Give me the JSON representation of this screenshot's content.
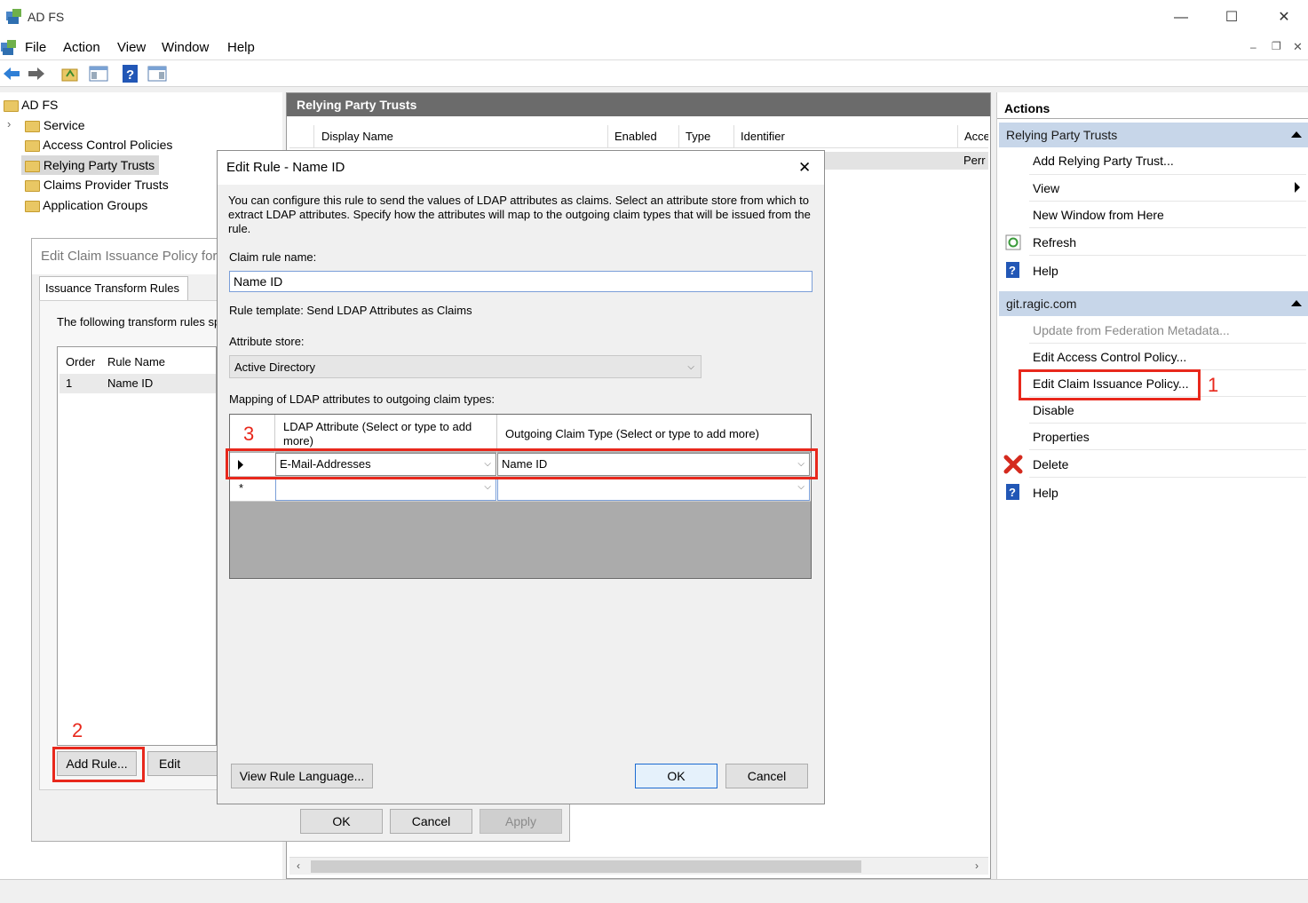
{
  "window": {
    "title": "AD FS",
    "minimize": "—",
    "maximize": "☐",
    "close": "✕"
  },
  "menu": [
    "File",
    "Action",
    "View",
    "Window",
    "Help"
  ],
  "mdi": {
    "minimize": "–",
    "restore": "❐",
    "close": "✕"
  },
  "tree": {
    "root": "AD FS",
    "items": [
      "Service",
      "Access Control Policies",
      "Relying Party Trusts",
      "Claims Provider Trusts",
      "Application Groups"
    ],
    "expander": "›"
  },
  "center": {
    "header": "Relying Party Trusts",
    "columns": [
      "Display Name",
      "Enabled",
      "Type",
      "Identifier",
      "Acce"
    ],
    "row_partial": "Perr"
  },
  "actions": {
    "title": "Actions",
    "section1": {
      "label": "Relying Party Trusts",
      "items": [
        "Add Relying Party Trust...",
        "View",
        "New Window from Here",
        "Refresh",
        "Help"
      ]
    },
    "section2": {
      "label": "git.ragic.com",
      "items": [
        "Update from Federation Metadata...",
        "Edit Access Control Policy...",
        "Edit Claim Issuance Policy...",
        "Disable",
        "Properties",
        "Delete",
        "Help"
      ]
    }
  },
  "claim_dialog": {
    "title": "Edit Claim Issuance Policy for",
    "tab": "Issuance Transform Rules",
    "intro": "The following transform rules sp",
    "columns": [
      "Order",
      "Rule Name"
    ],
    "rows": [
      {
        "order": "1",
        "name": "Name ID"
      }
    ],
    "buttons": {
      "add": "Add Rule...",
      "edit": "Edit Rule...",
      "ok": "OK",
      "cancel": "Cancel",
      "apply": "Apply"
    }
  },
  "edit_rule": {
    "title": "Edit Rule - Name ID",
    "close": "✕",
    "description": "You can configure this rule to send the values of LDAP attributes as claims. Select an attribute store from which to extract LDAP attributes. Specify how the attributes will map to the outgoing claim types that will be issued from the rule.",
    "claim_rule_name_label": "Claim rule name:",
    "claim_rule_name": "Name ID",
    "template": "Rule template: Send LDAP Attributes as Claims",
    "attribute_store_label": "Attribute store:",
    "attribute_store": "Active Directory",
    "mapping_label": "Mapping of LDAP attributes to outgoing claim types:",
    "col_ldap": "LDAP Attribute (Select or type to add more)",
    "col_outgoing": "Outgoing Claim Type (Select or type to add more)",
    "row1": {
      "ldap": "E-Mail-Addresses",
      "outgoing": "Name ID"
    },
    "new_row_marker": "*",
    "buttons": {
      "view_language": "View Rule Language...",
      "ok": "OK",
      "cancel": "Cancel"
    }
  },
  "annotations": {
    "one": "1",
    "two": "2",
    "three": "3"
  },
  "colors": {
    "red": "#e8281c",
    "section_blue": "#c7d6e9",
    "header_gray": "#6b6b6b"
  }
}
